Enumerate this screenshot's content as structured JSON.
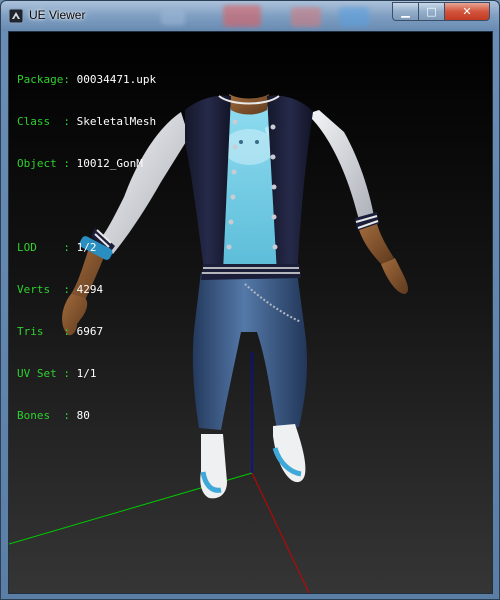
{
  "window": {
    "title": "UE Viewer",
    "min_symbol": "▁",
    "max_symbol": "□",
    "close_symbol": "✕"
  },
  "info": {
    "package": {
      "label": "Package:",
      "value": "00034471.upk"
    },
    "class": {
      "label": "Class  :",
      "value": "SkeletalMesh"
    },
    "object": {
      "label": "Object :",
      "value": "10012_GonM"
    },
    "lod": {
      "label": "LOD    :",
      "value": "1/2"
    },
    "verts": {
      "label": "Verts  :",
      "value": "4294"
    },
    "tris": {
      "label": "Tris   :",
      "value": "6967"
    },
    "uvset": {
      "label": "UV Set :",
      "value": "1/1"
    },
    "bones": {
      "label": "Bones  :",
      "value": "80"
    }
  },
  "colors": {
    "info_label": "#2fd02f",
    "info_value": "#ffffff",
    "axis_x": "#cc0000",
    "axis_y": "#00cc00",
    "axis_z": "#0000dd",
    "jacket": "#1b1e38",
    "sleeve": "#e4e6ea",
    "shirt": "#7ad0e6",
    "jeans": "#3a5c8a",
    "skin": "#8a5a33"
  }
}
